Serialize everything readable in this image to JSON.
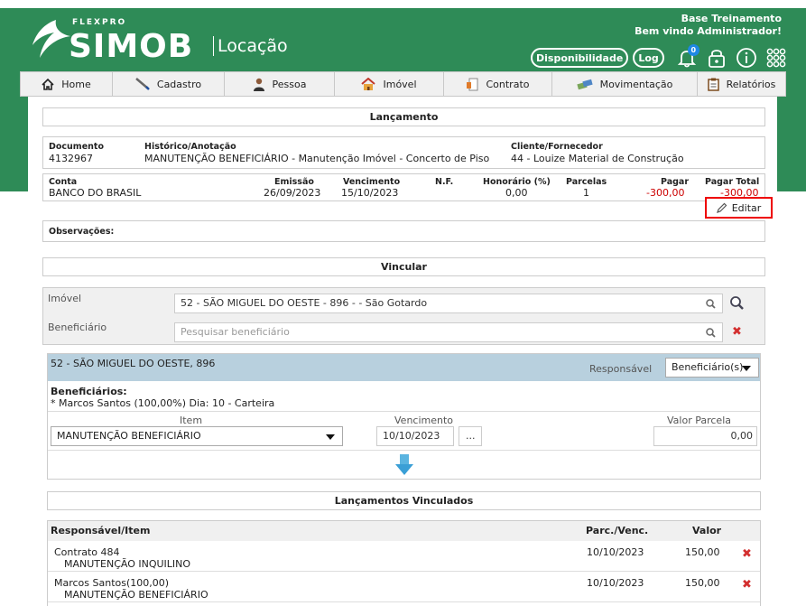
{
  "header": {
    "logo_sup": "FLEXPRO",
    "logo_brand": "SIMOB",
    "logo_sub": "Locação",
    "company": "Base Treinamento",
    "welcome": "Bem vindo Administrador!",
    "btn_disponibilidade": "Disponibilidade",
    "btn_log": "Log",
    "notif_count": "0"
  },
  "menu": {
    "items": [
      {
        "label": "Home",
        "icon": "home-icon"
      },
      {
        "label": "Cadastro",
        "icon": "pen-icon"
      },
      {
        "label": "Pessoa",
        "icon": "person-icon"
      },
      {
        "label": "Imóvel",
        "icon": "house-icon"
      },
      {
        "label": "Contrato",
        "icon": "contract-icon"
      },
      {
        "label": "Movimentação",
        "icon": "money-icon"
      },
      {
        "label": "Relatórios",
        "icon": "report-icon"
      }
    ]
  },
  "lancamento": {
    "title": "Lançamento",
    "documento_label": "Documento",
    "documento": "4132967",
    "historico_label": "Histórico/Anotação",
    "historico": "MANUTENÇÃO BENEFICIÁRIO - Manutenção Imóvel - Concerto de Piso",
    "cliente_label": "Cliente/Fornecedor",
    "cliente": "44 - Louize Material de Construção",
    "conta_label": "Conta",
    "conta": "BANCO DO BRASIL",
    "emissao_label": "Emissão",
    "emissao": "26/09/2023",
    "vencimento_label": "Vencimento",
    "vencimento": "15/10/2023",
    "nf_label": "N.F.",
    "honorario_label": "Honorário (%)",
    "honorario": "0,00",
    "parcelas_label": "Parcelas",
    "parcelas": "1",
    "pagar_label": "Pagar",
    "pagar": "-300,00",
    "pagar_total_label": "Pagar Total",
    "pagar_total": "-300,00",
    "editar": "Editar",
    "observacoes_label": "Observações:"
  },
  "vincular": {
    "title": "Vincular",
    "imovel_label": "Imóvel",
    "imovel_value": "52 - SÃO MIGUEL DO OESTE - 896 -  - São Gotardo",
    "beneficiario_label": "Beneficiário",
    "beneficiario_placeholder": "Pesquisar beneficiário"
  },
  "detalhe": {
    "property": "52 - SÃO MIGUEL DO OESTE, 896",
    "responsavel_label": "Responsável",
    "responsavel_value": "Beneficiário(s)",
    "beneficiarios_label": "Beneficiários:",
    "beneficiarios_line": "* Marcos Santos (100,00%) Dia: 10 - Carteira",
    "item_label": "Item",
    "item_value": "MANUTENÇÃO BENEFICIÁRIO",
    "vencimento_label": "Vencimento",
    "vencimento_value": "10/10/2023",
    "dots": "...",
    "valor_label": "Valor Parcela",
    "valor_value": "0,00"
  },
  "vinculados": {
    "title": "Lançamentos Vinculados",
    "col_resp": "Responsável/Item",
    "col_parc": "Parc./Venc.",
    "col_valor": "Valor",
    "rows": [
      {
        "resp": "Contrato 484",
        "item": "MANUTENÇÃO INQUILINO",
        "venc": "10/10/2023",
        "valor": "150,00"
      },
      {
        "resp": "Marcos Santos(100,00)",
        "item": "MANUTENÇÃO BENEFICIÁRIO",
        "venc": "10/10/2023",
        "valor": "150,00"
      }
    ]
  },
  "colors": {
    "brand_green": "#2e8b57",
    "accent_red": "#cc0000",
    "bar_blue": "#b8d0de"
  }
}
